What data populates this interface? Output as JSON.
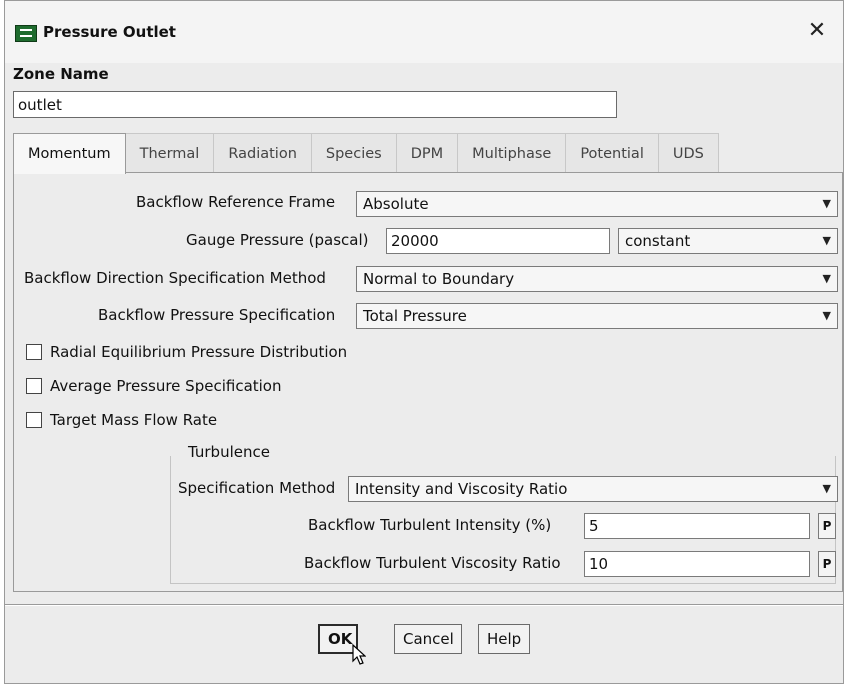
{
  "window": {
    "title": "Pressure Outlet",
    "close_icon": "close-icon",
    "app_icon": "fluent-app-icon"
  },
  "zone": {
    "label": "Zone Name",
    "value": "outlet"
  },
  "tabs": [
    {
      "label": "Momentum",
      "active": true
    },
    {
      "label": "Thermal"
    },
    {
      "label": "Radiation"
    },
    {
      "label": "Species"
    },
    {
      "label": "DPM"
    },
    {
      "label": "Multiphase"
    },
    {
      "label": "Potential"
    },
    {
      "label": "UDS"
    }
  ],
  "momentum": {
    "backflow_ref_frame": {
      "label": "Backflow Reference Frame",
      "value": "Absolute"
    },
    "gauge_pressure": {
      "label": "Gauge Pressure (pascal)",
      "value": "20000",
      "method": "constant"
    },
    "backflow_direction": {
      "label": "Backflow Direction Specification Method",
      "value": "Normal to Boundary"
    },
    "backflow_pressure": {
      "label": "Backflow Pressure Specification",
      "value": "Total Pressure"
    },
    "checkboxes": [
      {
        "label": "Radial Equilibrium Pressure Distribution",
        "checked": false
      },
      {
        "label": "Average Pressure Specification",
        "checked": false
      },
      {
        "label": "Target Mass Flow Rate",
        "checked": false
      }
    ],
    "turbulence": {
      "title": "Turbulence",
      "spec_method": {
        "label": "Specification Method",
        "value": "Intensity and Viscosity Ratio"
      },
      "intensity": {
        "label": "Backflow Turbulent Intensity (%)",
        "value": "5",
        "param": "P"
      },
      "viscosity_ratio": {
        "label": "Backflow Turbulent Viscosity Ratio",
        "value": "10",
        "param": "P"
      }
    }
  },
  "buttons": {
    "ok": "OK",
    "cancel": "Cancel",
    "help": "Help"
  },
  "colors": {
    "dialog_bg": "#ececec",
    "icon_green": "#1e6b2e"
  }
}
